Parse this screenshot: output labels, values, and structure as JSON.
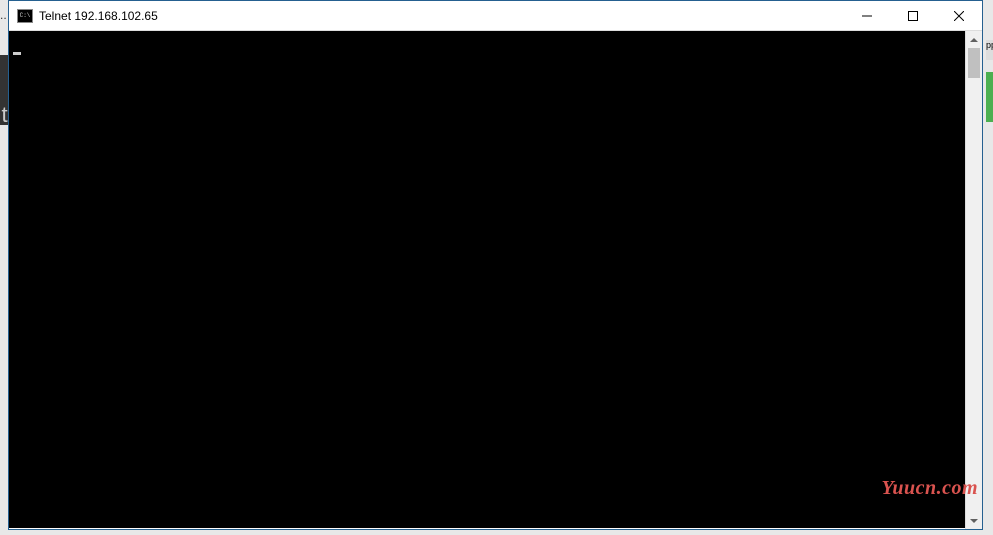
{
  "window": {
    "title": "Telnet 192.168.102.65",
    "app_icon_label": "C:\\"
  },
  "background": {
    "left_letter": "t",
    "right_label": "pp"
  },
  "terminal": {
    "content": ""
  },
  "watermark": {
    "text": "Yuucn.com"
  }
}
